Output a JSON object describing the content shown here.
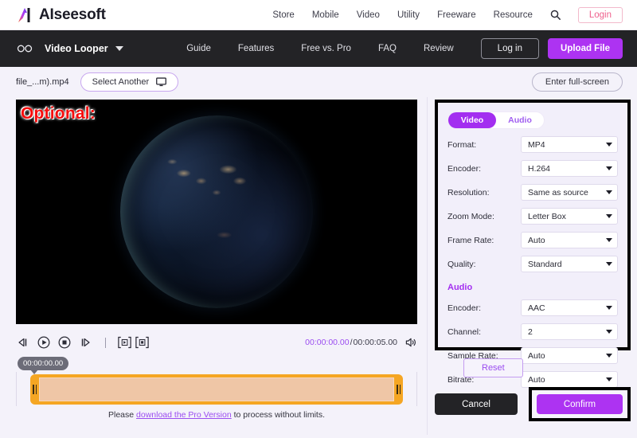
{
  "topbar": {
    "brand": "AIseesoft",
    "brand_logo_icon": "aiseesoft-logo-icon",
    "nav": [
      "Store",
      "Mobile",
      "Video",
      "Utility",
      "Freeware",
      "Resource"
    ],
    "search_icon": "search-icon",
    "login_label": "Login"
  },
  "darknav": {
    "loop_icon": "infinity-loop-icon",
    "product": "Video Looper",
    "caret_icon": "chevron-down-icon",
    "links": [
      "Guide",
      "Features",
      "Free vs. Pro",
      "FAQ",
      "Review"
    ],
    "login_label": "Log in",
    "upload_label": "Upload File"
  },
  "filebar": {
    "filename": "file_...m).mp4",
    "select_another": "Select Another",
    "monitor_icon": "monitor-icon",
    "fullscreen": "Enter full-screen"
  },
  "video": {
    "overlay_label": "Optional:",
    "overlay_color": "#f50c0c",
    "scene": "earth-night-from-space"
  },
  "controls": {
    "icons": [
      {
        "name": "previous-frame-icon"
      },
      {
        "name": "play-icon"
      },
      {
        "name": "stop-icon"
      },
      {
        "name": "next-frame-icon"
      }
    ],
    "mark_in_icon": "mark-in-bracket-icon",
    "mark_out_icon": "mark-out-bracket-icon",
    "current_time": "00:00:00.00",
    "time_separator": " /",
    "total_time": "00:00:05.00",
    "volume_icon": "volume-icon"
  },
  "timeline": {
    "tooltip_time": "00:00:00.00",
    "handle_left_icon": "trim-handle-left-icon",
    "handle_right_icon": "trim-handle-right-icon",
    "track_color": "#f5a623"
  },
  "pronote": {
    "before": "Please ",
    "link": "download the Pro Version",
    "after": " to process without limits."
  },
  "settings": {
    "tab_video": "Video",
    "tab_audio": "Audio",
    "accent": "#a32ef0",
    "video_rows": [
      {
        "label": "Format:",
        "value": "MP4"
      },
      {
        "label": "Encoder:",
        "value": "H.264"
      },
      {
        "label": "Resolution:",
        "value": "Same as source"
      },
      {
        "label": "Zoom Mode:",
        "value": "Letter Box"
      },
      {
        "label": "Frame Rate:",
        "value": "Auto"
      },
      {
        "label": "Quality:",
        "value": "Standard"
      }
    ],
    "audio_section_title": "Audio",
    "audio_rows": [
      {
        "label": "Encoder:",
        "value": "AAC"
      },
      {
        "label": "Channel:",
        "value": "2"
      },
      {
        "label": "Sample Rate:",
        "value": "Auto"
      },
      {
        "label": "Bitrate:",
        "value": "Auto"
      }
    ],
    "reset_label": "Reset",
    "cancel_label": "Cancel",
    "confirm_label": "Confirm"
  }
}
